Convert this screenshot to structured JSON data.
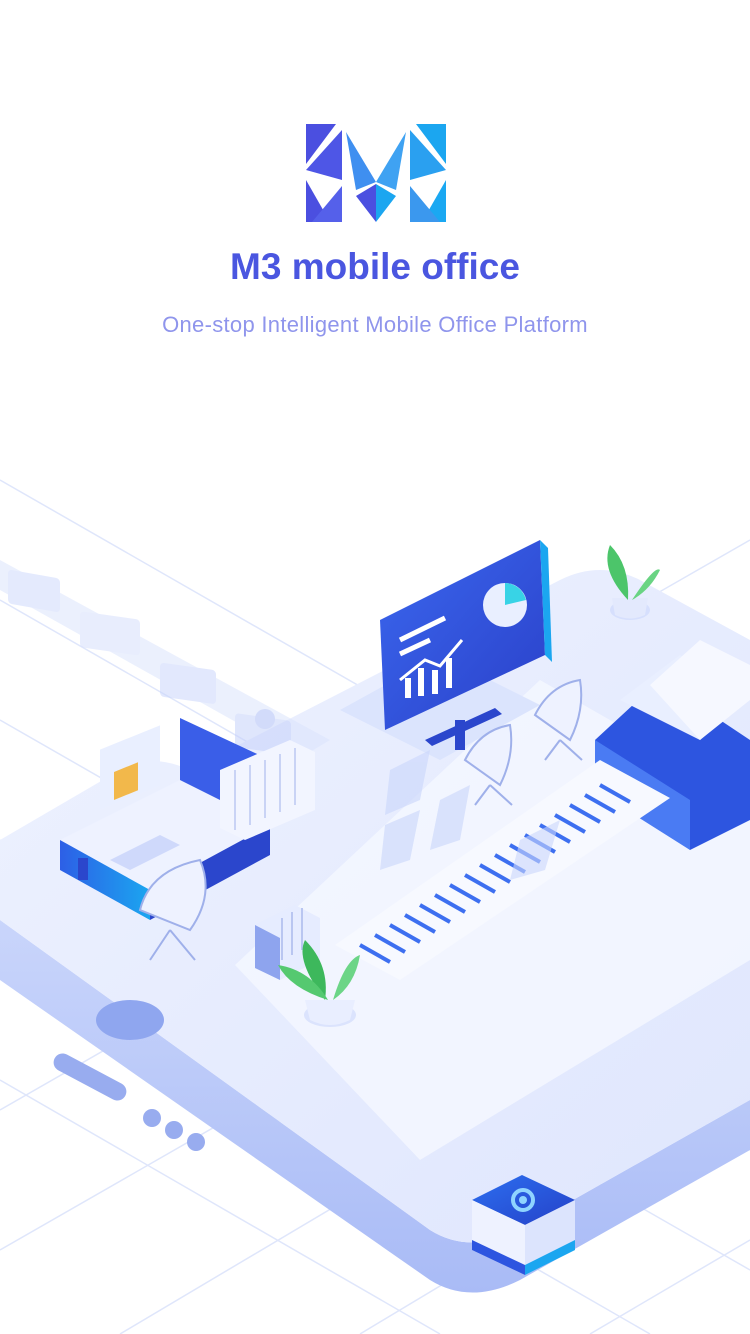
{
  "splash": {
    "title": "M3 mobile office",
    "subtitle": "One-stop Intelligent Mobile Office Platform"
  },
  "colors": {
    "brand": "#4a56e0",
    "brand_light": "#8f95ec",
    "accent_cyan": "#1ba6f0",
    "surface": "#e8eeff",
    "plant_green": "#4cc56a"
  },
  "icons": [
    "m3-logo",
    "monitor-chart-icon",
    "printer-icon",
    "plant-icon",
    "gear-icon"
  ]
}
